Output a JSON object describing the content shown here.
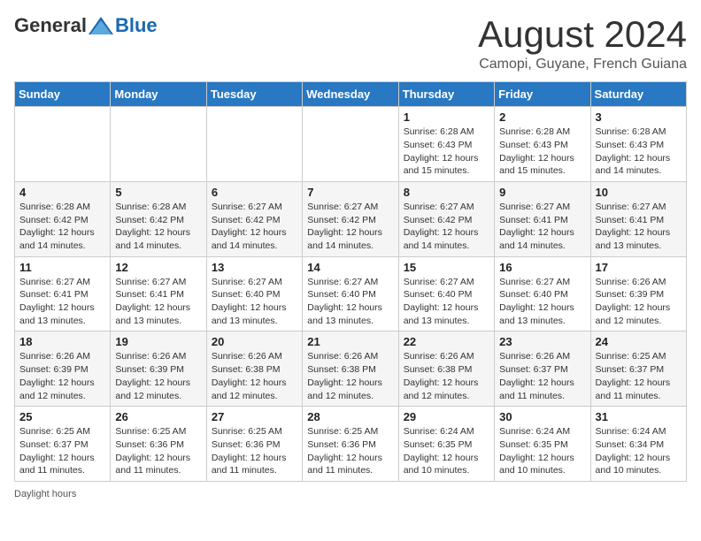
{
  "header": {
    "logo": {
      "general": "General",
      "blue": "Blue"
    },
    "title": "August 2024",
    "location": "Camopi, Guyane, French Guiana"
  },
  "calendar": {
    "days_of_week": [
      "Sunday",
      "Monday",
      "Tuesday",
      "Wednesday",
      "Thursday",
      "Friday",
      "Saturday"
    ],
    "weeks": [
      [
        {
          "day": "",
          "info": ""
        },
        {
          "day": "",
          "info": ""
        },
        {
          "day": "",
          "info": ""
        },
        {
          "day": "",
          "info": ""
        },
        {
          "day": "1",
          "info": "Sunrise: 6:28 AM\nSunset: 6:43 PM\nDaylight: 12 hours and 15 minutes."
        },
        {
          "day": "2",
          "info": "Sunrise: 6:28 AM\nSunset: 6:43 PM\nDaylight: 12 hours and 15 minutes."
        },
        {
          "day": "3",
          "info": "Sunrise: 6:28 AM\nSunset: 6:43 PM\nDaylight: 12 hours and 14 minutes."
        }
      ],
      [
        {
          "day": "4",
          "info": "Sunrise: 6:28 AM\nSunset: 6:42 PM\nDaylight: 12 hours and 14 minutes."
        },
        {
          "day": "5",
          "info": "Sunrise: 6:28 AM\nSunset: 6:42 PM\nDaylight: 12 hours and 14 minutes."
        },
        {
          "day": "6",
          "info": "Sunrise: 6:27 AM\nSunset: 6:42 PM\nDaylight: 12 hours and 14 minutes."
        },
        {
          "day": "7",
          "info": "Sunrise: 6:27 AM\nSunset: 6:42 PM\nDaylight: 12 hours and 14 minutes."
        },
        {
          "day": "8",
          "info": "Sunrise: 6:27 AM\nSunset: 6:42 PM\nDaylight: 12 hours and 14 minutes."
        },
        {
          "day": "9",
          "info": "Sunrise: 6:27 AM\nSunset: 6:41 PM\nDaylight: 12 hours and 14 minutes."
        },
        {
          "day": "10",
          "info": "Sunrise: 6:27 AM\nSunset: 6:41 PM\nDaylight: 12 hours and 13 minutes."
        }
      ],
      [
        {
          "day": "11",
          "info": "Sunrise: 6:27 AM\nSunset: 6:41 PM\nDaylight: 12 hours and 13 minutes."
        },
        {
          "day": "12",
          "info": "Sunrise: 6:27 AM\nSunset: 6:41 PM\nDaylight: 12 hours and 13 minutes."
        },
        {
          "day": "13",
          "info": "Sunrise: 6:27 AM\nSunset: 6:40 PM\nDaylight: 12 hours and 13 minutes."
        },
        {
          "day": "14",
          "info": "Sunrise: 6:27 AM\nSunset: 6:40 PM\nDaylight: 12 hours and 13 minutes."
        },
        {
          "day": "15",
          "info": "Sunrise: 6:27 AM\nSunset: 6:40 PM\nDaylight: 12 hours and 13 minutes."
        },
        {
          "day": "16",
          "info": "Sunrise: 6:27 AM\nSunset: 6:40 PM\nDaylight: 12 hours and 13 minutes."
        },
        {
          "day": "17",
          "info": "Sunrise: 6:26 AM\nSunset: 6:39 PM\nDaylight: 12 hours and 12 minutes."
        }
      ],
      [
        {
          "day": "18",
          "info": "Sunrise: 6:26 AM\nSunset: 6:39 PM\nDaylight: 12 hours and 12 minutes."
        },
        {
          "day": "19",
          "info": "Sunrise: 6:26 AM\nSunset: 6:39 PM\nDaylight: 12 hours and 12 minutes."
        },
        {
          "day": "20",
          "info": "Sunrise: 6:26 AM\nSunset: 6:38 PM\nDaylight: 12 hours and 12 minutes."
        },
        {
          "day": "21",
          "info": "Sunrise: 6:26 AM\nSunset: 6:38 PM\nDaylight: 12 hours and 12 minutes."
        },
        {
          "day": "22",
          "info": "Sunrise: 6:26 AM\nSunset: 6:38 PM\nDaylight: 12 hours and 12 minutes."
        },
        {
          "day": "23",
          "info": "Sunrise: 6:26 AM\nSunset: 6:37 PM\nDaylight: 12 hours and 11 minutes."
        },
        {
          "day": "24",
          "info": "Sunrise: 6:25 AM\nSunset: 6:37 PM\nDaylight: 12 hours and 11 minutes."
        }
      ],
      [
        {
          "day": "25",
          "info": "Sunrise: 6:25 AM\nSunset: 6:37 PM\nDaylight: 12 hours and 11 minutes."
        },
        {
          "day": "26",
          "info": "Sunrise: 6:25 AM\nSunset: 6:36 PM\nDaylight: 12 hours and 11 minutes."
        },
        {
          "day": "27",
          "info": "Sunrise: 6:25 AM\nSunset: 6:36 PM\nDaylight: 12 hours and 11 minutes."
        },
        {
          "day": "28",
          "info": "Sunrise: 6:25 AM\nSunset: 6:36 PM\nDaylight: 12 hours and 11 minutes."
        },
        {
          "day": "29",
          "info": "Sunrise: 6:24 AM\nSunset: 6:35 PM\nDaylight: 12 hours and 10 minutes."
        },
        {
          "day": "30",
          "info": "Sunrise: 6:24 AM\nSunset: 6:35 PM\nDaylight: 12 hours and 10 minutes."
        },
        {
          "day": "31",
          "info": "Sunrise: 6:24 AM\nSunset: 6:34 PM\nDaylight: 12 hours and 10 minutes."
        }
      ]
    ]
  },
  "footer": {
    "daylight_label": "Daylight hours"
  }
}
